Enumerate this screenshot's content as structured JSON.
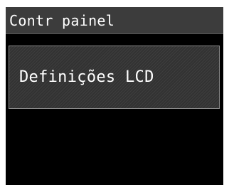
{
  "header": {
    "title": "Contr painel"
  },
  "menu": {
    "items": [
      {
        "label": "Definições LCD"
      }
    ]
  }
}
